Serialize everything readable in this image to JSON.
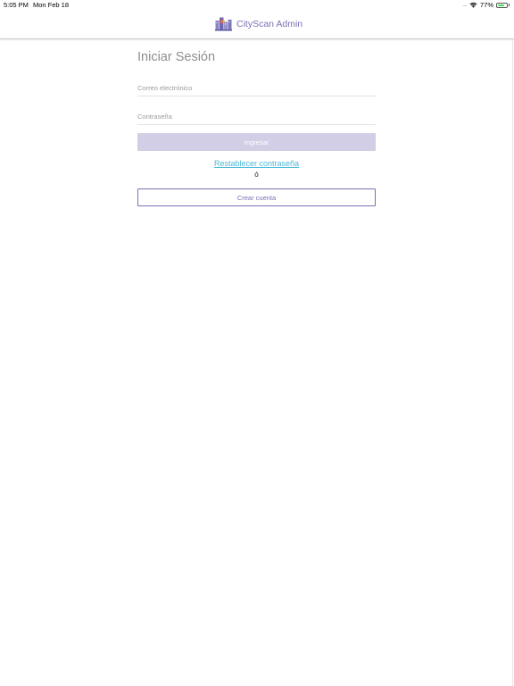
{
  "status_bar": {
    "time": "5:05 PM",
    "date": "Mon Feb 18",
    "signal": "....",
    "battery_percent": "77%",
    "battery_level": 0.77
  },
  "nav": {
    "title": "CityScan Admin",
    "logo_icon": "cityscan-logo-icon"
  },
  "login": {
    "title": "Iniciar Sesión",
    "email_placeholder": "Correo electrónico",
    "email_value": "",
    "password_placeholder": "Contraseña",
    "password_value": "",
    "submit_label": "Ingresar",
    "reset_link": "Restablecer contraseña",
    "or_text": "ó",
    "create_account_label": "Crear cuenta"
  },
  "colors": {
    "accent": "#7c6fb6",
    "button_disabled": "#d2cee6",
    "link": "#4fb8d8",
    "battery": "#4cd964"
  }
}
